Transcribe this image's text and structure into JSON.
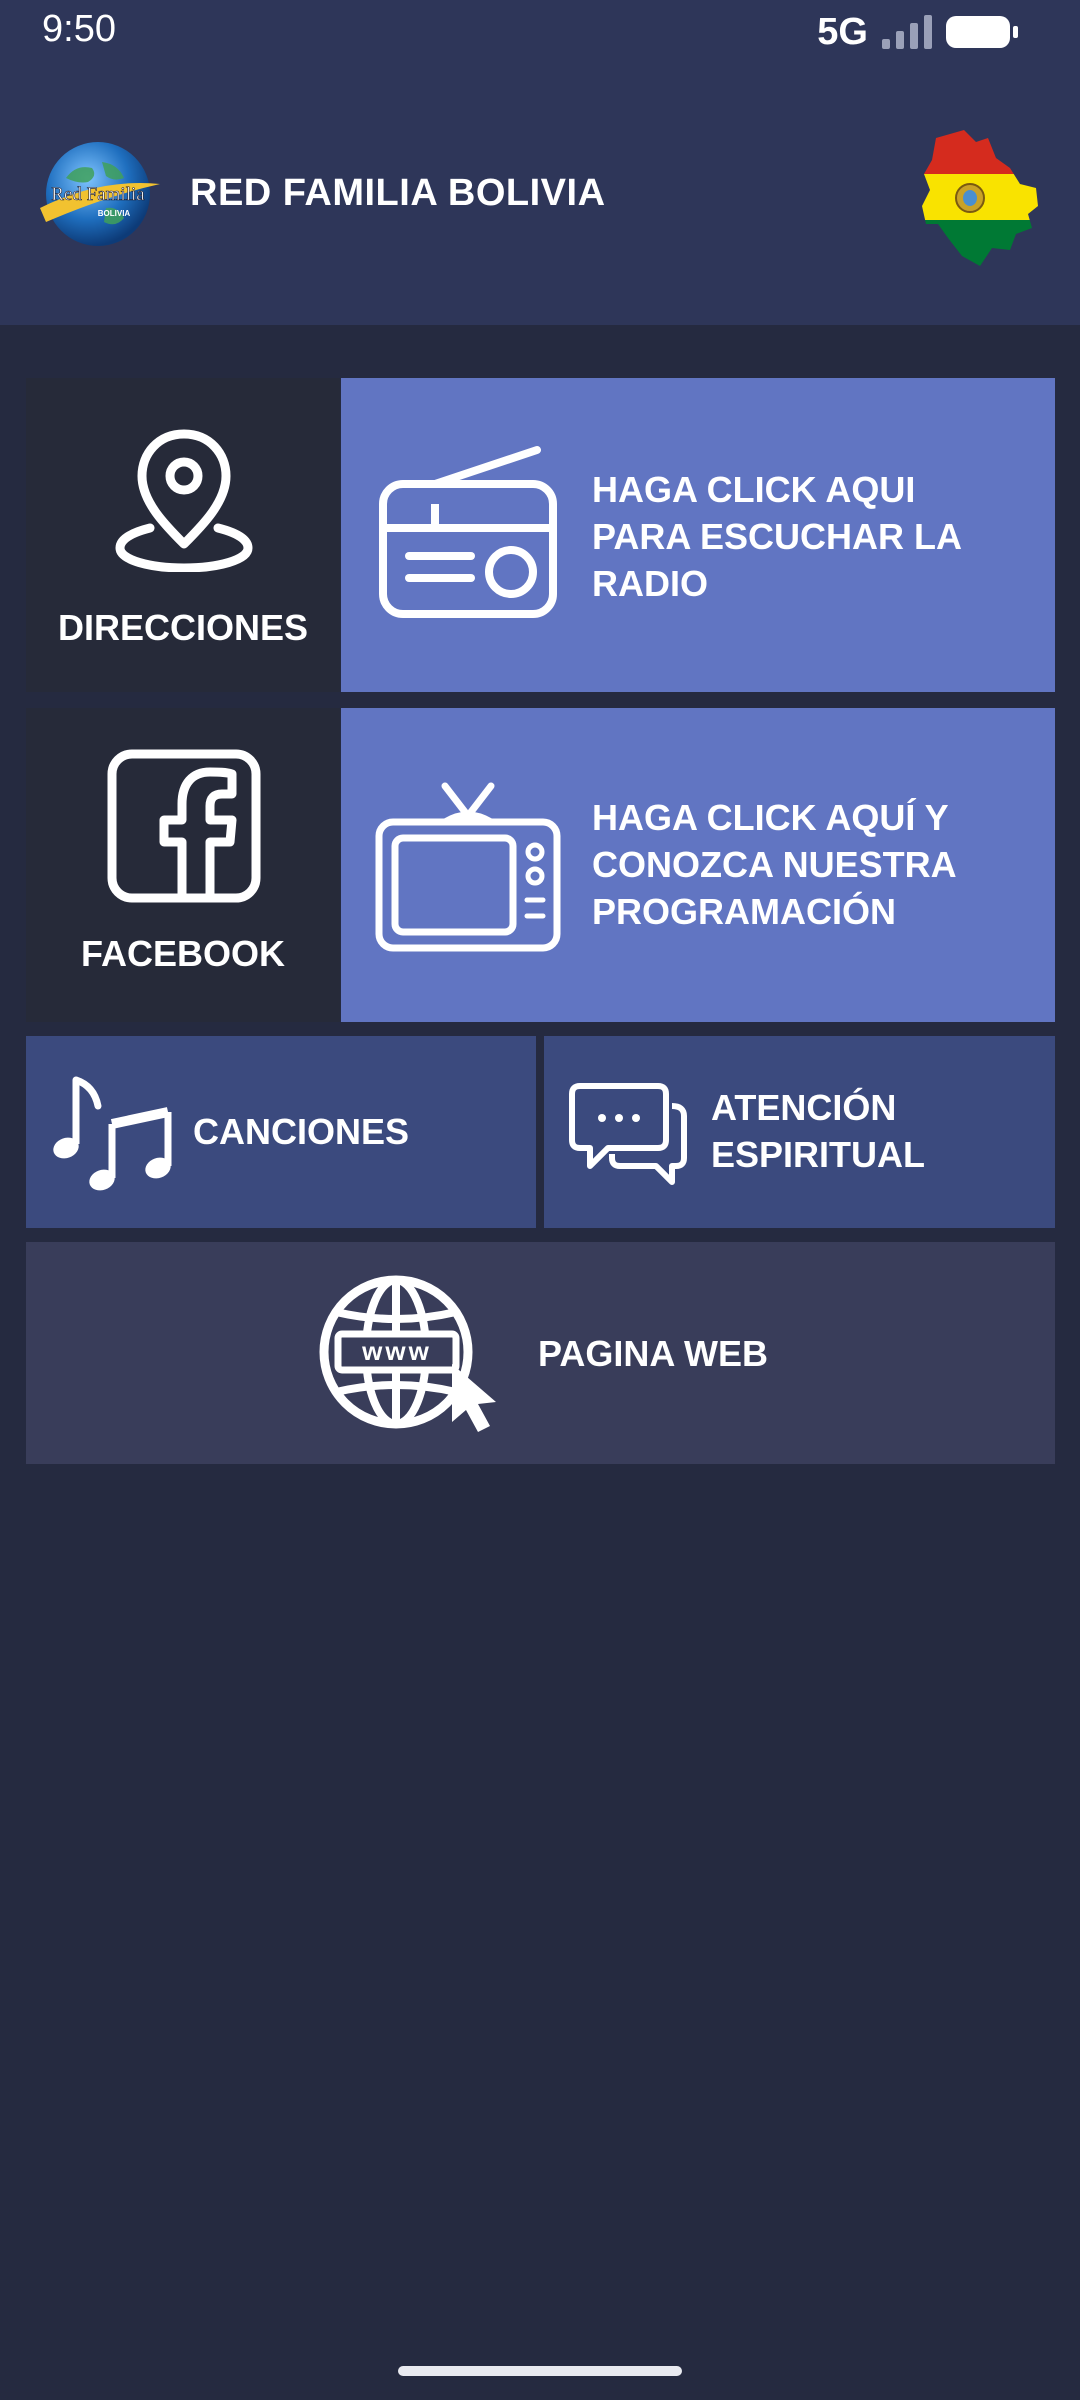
{
  "status_bar": {
    "time": "9:50",
    "network": "5G"
  },
  "app": {
    "title": "RED FAMILIA BOLIVIA",
    "logo_text": "Red Familia",
    "logo_subtext": "BOLIVIA"
  },
  "tiles": {
    "direcciones": {
      "label": "DIRECCIONES",
      "icon": "location-pin-icon"
    },
    "radio": {
      "line1": "HAGA CLICK AQUI",
      "line2": "PARA ESCUCHAR LA",
      "line3": "RADIO",
      "icon": "radio-icon"
    },
    "facebook": {
      "label": "FACEBOOK",
      "icon": "facebook-icon"
    },
    "tv": {
      "line1": "HAGA CLICK AQUÍ Y",
      "line2": "CONOZCA NUESTRA",
      "line3": "PROGRAMACIÓN",
      "icon": "tv-icon"
    },
    "canciones": {
      "label": "CANCIONES",
      "icon": "music-notes-icon"
    },
    "atencion": {
      "line1": "ATENCIÓN",
      "line2": "ESPIRITUAL",
      "icon": "chat-bubbles-icon"
    },
    "web": {
      "label": "PAGINA WEB",
      "www": "www",
      "icon": "globe-www-icon"
    }
  },
  "colors": {
    "header": "#2e3659",
    "background": "#252a40",
    "dark_tile": "#262a39",
    "blue_tile": "#6175c2",
    "mid_tile": "#3b4a7e",
    "web_tile": "#393d5a"
  }
}
